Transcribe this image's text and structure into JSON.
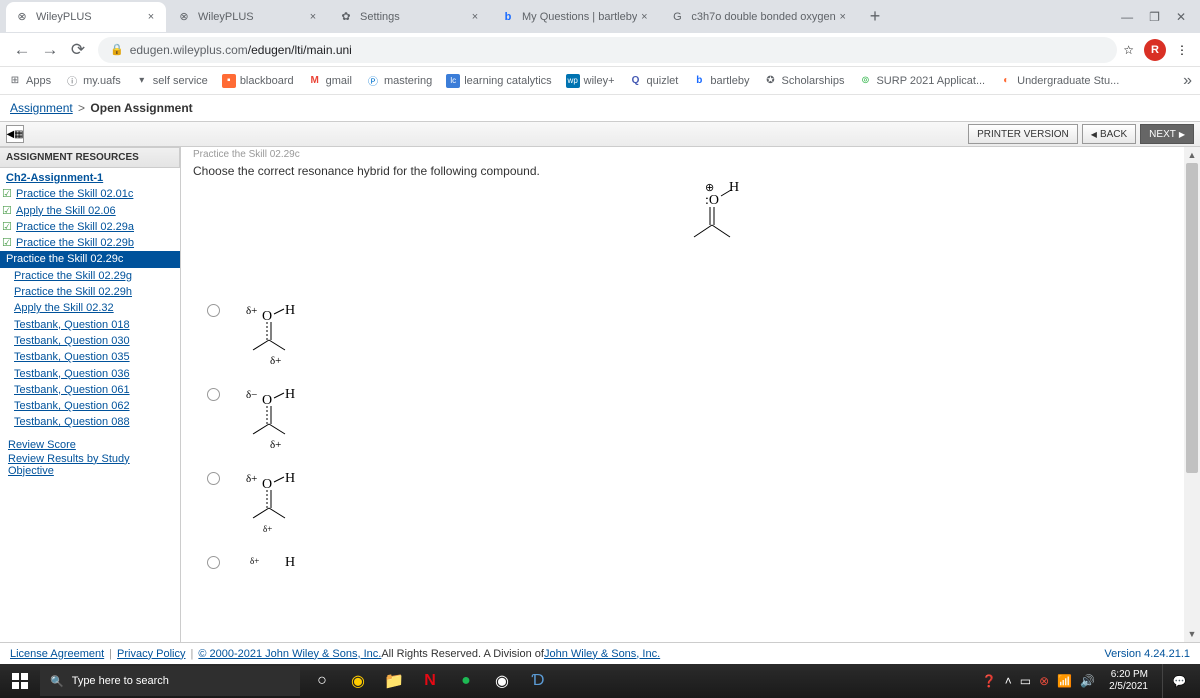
{
  "tabs": [
    {
      "title": "WileyPLUS",
      "favicon": "⊗"
    },
    {
      "title": "WileyPLUS",
      "favicon": "⊗"
    },
    {
      "title": "Settings",
      "favicon": "✿"
    },
    {
      "title": "My Questions | bartleby",
      "favicon": "b"
    },
    {
      "title": "c3h7o double bonded oxygen",
      "favicon": "G"
    }
  ],
  "url": {
    "host": "edugen.wileyplus.com",
    "path": "/edugen/lti/main.uni"
  },
  "bookmarks": [
    {
      "label": "Apps",
      "icon": "⊞"
    },
    {
      "label": "my.uafs",
      "icon": "ⓘ"
    },
    {
      "label": "self service",
      "icon": "▾"
    },
    {
      "label": "blackboard",
      "icon": "▪"
    },
    {
      "label": "gmail",
      "icon": "M"
    },
    {
      "label": "mastering",
      "icon": "Ⓟ"
    },
    {
      "label": "learning catalytics",
      "icon": "lc"
    },
    {
      "label": "wiley+",
      "icon": "wp"
    },
    {
      "label": "quizlet",
      "icon": "Q"
    },
    {
      "label": "bartleby",
      "icon": "b"
    },
    {
      "label": "Scholarships",
      "icon": "✪"
    },
    {
      "label": "SURP 2021 Applicat...",
      "icon": "⊚"
    },
    {
      "label": "Undergraduate Stu...",
      "icon": "◐"
    }
  ],
  "breadcrumb": {
    "root": "Assignment",
    "current": "Open Assignment"
  },
  "toolbar": {
    "printer": "PRINTER VERSION",
    "back": "BACK",
    "next": "NEXT"
  },
  "sidebar": {
    "header": "ASSIGNMENT RESOURCES",
    "assignment": "Ch2-Assignment-1",
    "items": [
      {
        "label": "Practice the Skill 02.01c",
        "checked": true
      },
      {
        "label": "Apply the Skill 02.06",
        "checked": true
      },
      {
        "label": "Practice the Skill 02.29a",
        "checked": true
      },
      {
        "label": "Practice the Skill 02.29b",
        "checked": true
      },
      {
        "label": "Practice the Skill 02.29c",
        "current": true
      },
      {
        "label": "Practice the Skill 02.29g"
      },
      {
        "label": "Practice the Skill 02.29h"
      },
      {
        "label": "Apply the Skill 02.32"
      },
      {
        "label": "Testbank, Question 018"
      },
      {
        "label": "Testbank, Question 030"
      },
      {
        "label": "Testbank, Question 035"
      },
      {
        "label": "Testbank, Question 036"
      },
      {
        "label": "Testbank, Question 061"
      },
      {
        "label": "Testbank, Question 062"
      },
      {
        "label": "Testbank, Question 088"
      }
    ],
    "links": [
      "Review Score",
      "Review Results by Study Objective"
    ]
  },
  "question": {
    "crumb": "Practice the Skill 02.29c",
    "text": "Choose the correct resonance hybrid for the following compound."
  },
  "footer": {
    "license": "License Agreement",
    "privacy": "Privacy Policy",
    "copyright": "© 2000-2021 John Wiley & Sons, Inc.",
    "rights": " All Rights Reserved. A Division of ",
    "wiley": "John Wiley & Sons, Inc.",
    "version": "Version 4.24.21.1"
  },
  "taskbar": {
    "search": "Type here to search",
    "time": "6:20 PM",
    "date": "2/5/2021"
  }
}
